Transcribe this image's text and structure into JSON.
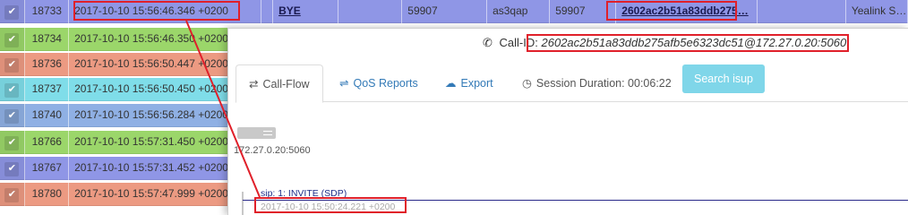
{
  "colors": {
    "row_purple": "#8f96e6",
    "row_green": "#9bd66a",
    "row_salmon": "#ec9a82",
    "row_cyan": "#7fdde9",
    "row_blue": "#8fb0e4",
    "highlight_red": "#e0202a",
    "button_cyan": "#7fd6e9",
    "link_blue": "#337ab7"
  },
  "table": {
    "rows": [
      {
        "check_icon": "check-icon",
        "id": "18733",
        "date": "2017-10-10 15:56:46.346 +0200",
        "method": "BYE",
        "source_port": "59907",
        "user": "as3qap",
        "dest_port": "59907",
        "call_id": "2602ac2b51a83ddb275…",
        "user_agent": "Yealink S…",
        "color": "#8f96e6"
      },
      {
        "check_icon": "check-icon",
        "id": "18734",
        "date": "2017-10-10 15:56:46.350 +0200",
        "color": "#9bd66a"
      },
      {
        "check_icon": "check-icon",
        "id": "18736",
        "date": "2017-10-10 15:56:50.447 +0200",
        "color": "#ec9a82"
      },
      {
        "check_icon": "check-icon",
        "id": "18737",
        "date": "2017-10-10 15:56:50.450 +0200",
        "color": "#7fdde9"
      },
      {
        "check_icon": "check-icon",
        "id": "18740",
        "date": "2017-10-10 15:56:56.284 +0200",
        "color": "#8fb0e4"
      },
      {
        "check_icon": "check-icon",
        "id": "18766",
        "date": "2017-10-10 15:57:31.450 +0200",
        "color": "#9bd66a"
      },
      {
        "check_icon": "check-icon",
        "id": "18767",
        "date": "2017-10-10 15:57:31.452 +0200",
        "color": "#8f96e6"
      },
      {
        "check_icon": "check-icon",
        "id": "18780",
        "date": "2017-10-10 15:57:47.999 +0200",
        "color": "#ec9a82"
      }
    ]
  },
  "modal": {
    "callid_label": "Call-ID:",
    "callid_value": "2602ac2b51a83ddb275afb5e6323dc51@172.27.0.20:5060",
    "tabs": {
      "callflow": "Call-Flow",
      "qos": "QoS Reports",
      "export": "Export",
      "session": "Session Duration: 00:06:22"
    },
    "search_button": "Search isup",
    "flow": {
      "host": "172.27.0.20:5060",
      "message": "sip: 1: INVITE  (SDP)",
      "timestamp": "2017-10-10 15:50:24.221 +0200"
    }
  }
}
